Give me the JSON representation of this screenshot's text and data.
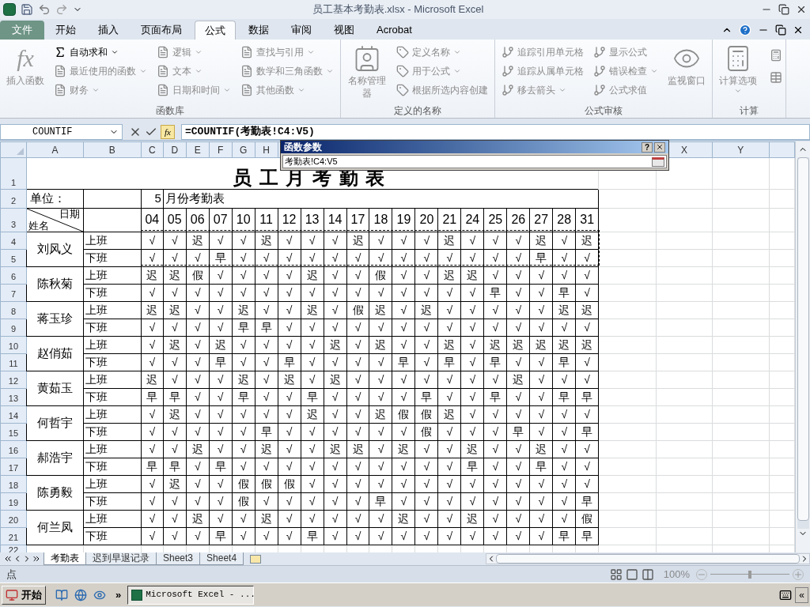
{
  "window": {
    "title": "员工基本考勤表.xlsx - Microsoft Excel"
  },
  "ribbon_tabs": [
    {
      "label": "文件",
      "kind": "file",
      "selected": false
    },
    {
      "label": "开始",
      "kind": "tab",
      "selected": false
    },
    {
      "label": "插入",
      "kind": "tab",
      "selected": false
    },
    {
      "label": "页面布局",
      "kind": "tab",
      "selected": false
    },
    {
      "label": "公式",
      "kind": "tab",
      "selected": true
    },
    {
      "label": "数据",
      "kind": "tab",
      "selected": false
    },
    {
      "label": "审阅",
      "kind": "tab",
      "selected": false
    },
    {
      "label": "视图",
      "kind": "tab",
      "selected": false
    },
    {
      "label": "Acrobat",
      "kind": "tab",
      "selected": false
    }
  ],
  "ribbon_groups": [
    {
      "label": "函数库",
      "columns": [
        {
          "kind": "large",
          "items": [
            {
              "label": "插入函数",
              "glyph": "fx",
              "disabled": true,
              "dropdown": false
            }
          ]
        },
        {
          "kind": "small",
          "items": [
            {
              "label": "自动求和",
              "disabled": false,
              "dropdown": true
            },
            {
              "label": "最近使用的函数",
              "disabled": true,
              "dropdown": true
            },
            {
              "label": "财务",
              "disabled": true,
              "dropdown": true
            }
          ]
        },
        {
          "kind": "small",
          "items": [
            {
              "label": "逻辑",
              "disabled": true,
              "dropdown": true
            },
            {
              "label": "文本",
              "disabled": true,
              "dropdown": true
            },
            {
              "label": "日期和时间",
              "disabled": true,
              "dropdown": true
            }
          ]
        },
        {
          "kind": "small",
          "items": [
            {
              "label": "查找与引用",
              "disabled": true,
              "dropdown": true
            },
            {
              "label": "数学和三角函数",
              "disabled": true,
              "dropdown": true
            },
            {
              "label": "其他函数",
              "disabled": true,
              "dropdown": true
            }
          ]
        }
      ]
    },
    {
      "label": "定义的名称",
      "columns": [
        {
          "kind": "large",
          "items": [
            {
              "label": "名称管理器",
              "disabled": true,
              "dropdown": false
            }
          ]
        },
        {
          "kind": "small",
          "items": [
            {
              "label": "定义名称",
              "disabled": true,
              "dropdown": true
            },
            {
              "label": "用于公式",
              "disabled": true,
              "dropdown": true
            },
            {
              "label": "根据所选内容创建",
              "disabled": true,
              "dropdown": false
            }
          ]
        }
      ]
    },
    {
      "label": "公式审核",
      "columns": [
        {
          "kind": "small",
          "items": [
            {
              "label": "追踪引用单元格",
              "disabled": true,
              "dropdown": false
            },
            {
              "label": "追踪从属单元格",
              "disabled": true,
              "dropdown": false
            },
            {
              "label": "移去箭头",
              "disabled": true,
              "dropdown": true
            }
          ]
        },
        {
          "kind": "small",
          "items": [
            {
              "label": "显示公式",
              "disabled": true,
              "dropdown": false
            },
            {
              "label": "错误检查",
              "disabled": true,
              "dropdown": true
            },
            {
              "label": "公式求值",
              "disabled": true,
              "dropdown": false
            }
          ]
        },
        {
          "kind": "large",
          "items": [
            {
              "label": "监视窗口",
              "disabled": true,
              "dropdown": false
            }
          ]
        }
      ]
    },
    {
      "label": "计算",
      "columns": [
        {
          "kind": "large",
          "items": [
            {
              "label": "计算选项",
              "disabled": true,
              "dropdown": true
            }
          ]
        }
      ]
    }
  ],
  "formula_bar": {
    "name_box": "COUNTIF",
    "insert_function": "fx",
    "formula": "=COUNTIF(考勤表!C4:V5)"
  },
  "dialog": {
    "title": "函数参数",
    "help": "?",
    "value": "考勤表!C4:V5"
  },
  "column_headers_left": [
    "A",
    "B",
    "C",
    "D",
    "E",
    "F",
    "G",
    "H"
  ],
  "column_headers_right": [
    "X",
    "Y"
  ],
  "row_numbers": [
    "1",
    "2",
    "3",
    "4",
    "5",
    "6",
    "7",
    "8",
    "9",
    "10",
    "11",
    "12",
    "13",
    "14",
    "15",
    "16",
    "17",
    "18",
    "19",
    "20",
    "21",
    "22"
  ],
  "sheet": {
    "title": "员工月考勤表",
    "unit_label": "单位：",
    "month": "5",
    "month_label": "月份考勤表",
    "corner_top": "日期",
    "corner_bottom": "姓名",
    "copy_marquee": true,
    "days": [
      "04",
      "05",
      "06",
      "07",
      "10",
      "11",
      "12",
      "13",
      "14",
      "17",
      "18",
      "19",
      "20",
      "21",
      "24",
      "25",
      "26",
      "27",
      "28",
      "31"
    ],
    "employees": [
      {
        "name": "刘风义",
        "shifts": [
          {
            "label": "上班",
            "marks": [
              "√",
              "√",
              "迟",
              "√",
              "√",
              "迟",
              "√",
              "√",
              "√",
              "迟",
              "√",
              "√",
              "√",
              "迟",
              "√",
              "√",
              "√",
              "迟",
              "√",
              "迟"
            ]
          },
          {
            "label": "下班",
            "marks": [
              "√",
              "√",
              "√",
              "早",
              "√",
              "√",
              "√",
              "√",
              "√",
              "√",
              "√",
              "√",
              "√",
              "√",
              "√",
              "√",
              "√",
              "早",
              "√",
              "√"
            ]
          }
        ]
      },
      {
        "name": "陈秋菊",
        "shifts": [
          {
            "label": "上班",
            "marks": [
              "迟",
              "迟",
              "假",
              "√",
              "√",
              "√",
              "√",
              "迟",
              "√",
              "√",
              "假",
              "√",
              "√",
              "迟",
              "迟",
              "√",
              "√",
              "√",
              "√",
              "√"
            ]
          },
          {
            "label": "下班",
            "marks": [
              "√",
              "√",
              "√",
              "√",
              "√",
              "√",
              "√",
              "√",
              "√",
              "√",
              "√",
              "√",
              "√",
              "√",
              "√",
              "早",
              "√",
              "√",
              "早",
              "√"
            ]
          }
        ]
      },
      {
        "name": "蒋玉珍",
        "shifts": [
          {
            "label": "上班",
            "marks": [
              "迟",
              "迟",
              "√",
              "√",
              "迟",
              "√",
              "√",
              "迟",
              "√",
              "假",
              "迟",
              "√",
              "迟",
              "√",
              "√",
              "√",
              "√",
              "√",
              "迟",
              "迟"
            ]
          },
          {
            "label": "下班",
            "marks": [
              "√",
              "√",
              "√",
              "√",
              "早",
              "早",
              "√",
              "√",
              "√",
              "√",
              "√",
              "√",
              "√",
              "√",
              "√",
              "√",
              "√",
              "√",
              "√",
              "√"
            ]
          }
        ]
      },
      {
        "name": "赵俏茹",
        "shifts": [
          {
            "label": "上班",
            "marks": [
              "√",
              "迟",
              "√",
              "迟",
              "√",
              "√",
              "√",
              "√",
              "迟",
              "√",
              "迟",
              "√",
              "√",
              "迟",
              "√",
              "迟",
              "迟",
              "迟",
              "迟",
              "迟"
            ]
          },
          {
            "label": "下班",
            "marks": [
              "√",
              "√",
              "√",
              "早",
              "√",
              "√",
              "早",
              "√",
              "√",
              "√",
              "√",
              "早",
              "√",
              "早",
              "√",
              "早",
              "√",
              "√",
              "早",
              "√"
            ]
          }
        ]
      },
      {
        "name": "黄茹玉",
        "shifts": [
          {
            "label": "上班",
            "marks": [
              "迟",
              "√",
              "√",
              "√",
              "迟",
              "√",
              "迟",
              "√",
              "迟",
              "√",
              "√",
              "√",
              "√",
              "√",
              "√",
              "√",
              "迟",
              "√",
              "√",
              "√"
            ]
          },
          {
            "label": "下班",
            "marks": [
              "早",
              "早",
              "√",
              "√",
              "早",
              "√",
              "√",
              "早",
              "√",
              "√",
              "√",
              "√",
              "早",
              "√",
              "√",
              "早",
              "√",
              "√",
              "早",
              "早"
            ]
          }
        ]
      },
      {
        "name": "何哲宇",
        "shifts": [
          {
            "label": "上班",
            "marks": [
              "√",
              "迟",
              "√",
              "√",
              "√",
              "√",
              "√",
              "迟",
              "√",
              "√",
              "迟",
              "假",
              "假",
              "迟",
              "√",
              "√",
              "√",
              "√",
              "√",
              "√"
            ]
          },
          {
            "label": "下班",
            "marks": [
              "√",
              "√",
              "√",
              "√",
              "√",
              "早",
              "√",
              "√",
              "√",
              "√",
              "√",
              "√",
              "假",
              "√",
              "√",
              "√",
              "早",
              "√",
              "√",
              "早"
            ]
          }
        ]
      },
      {
        "name": "郝浩宇",
        "shifts": [
          {
            "label": "上班",
            "marks": [
              "√",
              "√",
              "迟",
              "√",
              "√",
              "迟",
              "√",
              "√",
              "迟",
              "迟",
              "√",
              "迟",
              "√",
              "√",
              "迟",
              "√",
              "√",
              "迟",
              "√",
              "√"
            ]
          },
          {
            "label": "下班",
            "marks": [
              "早",
              "早",
              "√",
              "早",
              "√",
              "√",
              "√",
              "√",
              "√",
              "√",
              "√",
              "√",
              "√",
              "√",
              "早",
              "√",
              "√",
              "早",
              "√",
              "√"
            ]
          }
        ]
      },
      {
        "name": "陈勇毅",
        "shifts": [
          {
            "label": "上班",
            "marks": [
              "√",
              "迟",
              "√",
              "√",
              "假",
              "假",
              "假",
              "√",
              "√",
              "√",
              "√",
              "√",
              "√",
              "√",
              "√",
              "√",
              "√",
              "√",
              "√",
              "√"
            ]
          },
          {
            "label": "下班",
            "marks": [
              "√",
              "√",
              "√",
              "√",
              "假",
              "√",
              "√",
              "√",
              "√",
              "√",
              "早",
              "√",
              "√",
              "√",
              "√",
              "√",
              "√",
              "√",
              "√",
              "早"
            ]
          }
        ]
      },
      {
        "name": "何兰凤",
        "shifts": [
          {
            "label": "上班",
            "marks": [
              "√",
              "√",
              "迟",
              "√",
              "√",
              "迟",
              "√",
              "√",
              "√",
              "√",
              "√",
              "迟",
              "√",
              "√",
              "迟",
              "√",
              "√",
              "√",
              "√",
              "假"
            ]
          },
          {
            "label": "下班",
            "marks": [
              "√",
              "√",
              "√",
              "早",
              "√",
              "√",
              "√",
              "早",
              "√",
              "√",
              "√",
              "√",
              "√",
              "√",
              "√",
              "√",
              "√",
              "√",
              "早",
              "早"
            ]
          }
        ]
      }
    ]
  },
  "sheet_tabs": [
    {
      "label": "考勤表",
      "selected": true
    },
    {
      "label": "迟到早退记录",
      "selected": false
    },
    {
      "label": "Sheet3",
      "selected": false
    },
    {
      "label": "Sheet4",
      "selected": false
    }
  ],
  "status_bar": {
    "mode": "点",
    "zoom": "100%",
    "zoom_slider": {
      "level": 0.5
    }
  },
  "taskbar": {
    "start": "开始",
    "more": "»",
    "task": "Microsoft Excel - ...",
    "tray_toggle": "«"
  }
}
